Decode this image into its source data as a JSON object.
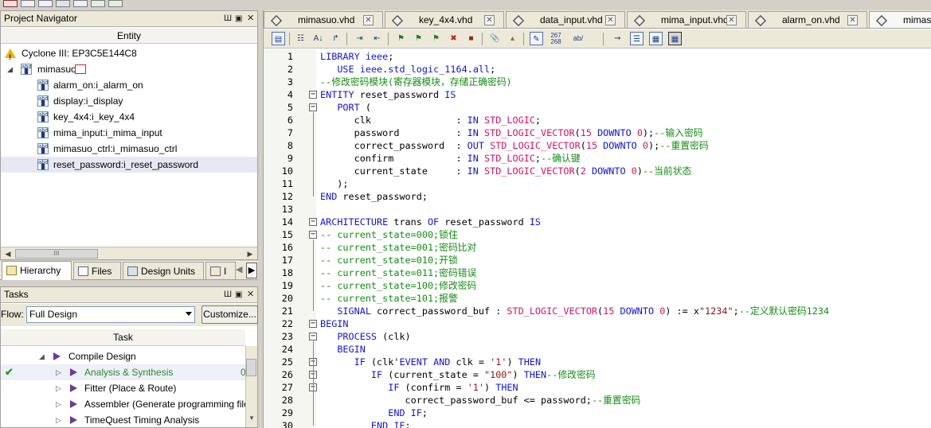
{
  "navigator": {
    "title": "Project Navigator",
    "pin_label": "Ш",
    "column": "Entity",
    "device": "Cyclone III: EP3C5E144C8",
    "root": "mimasuo",
    "children": [
      "alarm_on:i_alarm_on",
      "display:i_display",
      "key_4x4:i_key_4x4",
      "mima_input:i_mima_input",
      "mimasuo_ctrl:i_mimasuo_ctrl",
      "reset_password:i_reset_password"
    ],
    "scroll_thumb": "III",
    "tabs": [
      "Hierarchy",
      "Files",
      "Design Units",
      "I"
    ]
  },
  "tasks": {
    "title": "Tasks",
    "flow_label": "Flow:",
    "flow_value": "Full Design",
    "customize_label": "Customize...",
    "column": "Task",
    "rows": [
      {
        "label": "Compile Design",
        "status": ""
      },
      {
        "label": "Analysis & Synthesis",
        "status": "done",
        "progress": "0"
      },
      {
        "label": "Fitter (Place & Route)",
        "status": ""
      },
      {
        "label": "Assembler (Generate programming files)",
        "status": ""
      },
      {
        "label": "TimeQuest Timing Analysis",
        "status": ""
      }
    ]
  },
  "editor": {
    "tabs": [
      "mimasuo.vhd",
      "key_4x4.vhd",
      "data_input.vhd",
      "mima_input.vhd",
      "alarm_on.vhd",
      "mimasuo"
    ],
    "toolbar_text": {
      "linenum": "267\n268",
      "ab": "ab/"
    },
    "first_line": 1
  },
  "colors": {
    "keyword": "#1414d2",
    "type": "#d01464",
    "comment": "#148c14",
    "string": "#8c1414",
    "tab_bg": "#ece9d8"
  },
  "code_lines": [
    [
      [
        "kw",
        "LIBRARY"
      ],
      [
        "t",
        " "
      ],
      [
        "kw",
        "ieee"
      ],
      [
        "t",
        ";"
      ]
    ],
    [
      [
        "t",
        "   "
      ],
      [
        "kw",
        "USE"
      ],
      [
        "t",
        " "
      ],
      [
        "kw",
        "ieee"
      ],
      [
        "t",
        "."
      ],
      [
        "kw",
        "std_logic_1164"
      ],
      [
        "t",
        "."
      ],
      [
        "kw",
        "all"
      ],
      [
        "t",
        ";"
      ]
    ],
    [
      [
        "cm",
        "--修改密码模块(寄存器模块，存储正确密码)"
      ]
    ],
    [
      [
        "kw",
        "ENTITY"
      ],
      [
        "t",
        " reset_password "
      ],
      [
        "kw",
        "IS"
      ]
    ],
    [
      [
        "t",
        "   "
      ],
      [
        "kw",
        "PORT"
      ],
      [
        "t",
        " ("
      ]
    ],
    [
      [
        "t",
        "      clk               : "
      ],
      [
        "kw",
        "IN"
      ],
      [
        "t",
        " "
      ],
      [
        "ty",
        "STD_LOGIC"
      ],
      [
        "t",
        ";"
      ]
    ],
    [
      [
        "t",
        "      password          : "
      ],
      [
        "kw",
        "IN"
      ],
      [
        "t",
        " "
      ],
      [
        "ty",
        "STD_LOGIC_VECTOR"
      ],
      [
        "t",
        "("
      ],
      [
        "nm",
        "15"
      ],
      [
        "t",
        " "
      ],
      [
        "kw",
        "DOWNTO"
      ],
      [
        "t",
        " "
      ],
      [
        "nm",
        "0"
      ],
      [
        "t",
        ");"
      ],
      [
        "cm",
        "--输入密码"
      ]
    ],
    [
      [
        "t",
        "      correct_password  : "
      ],
      [
        "kw",
        "OUT"
      ],
      [
        "t",
        " "
      ],
      [
        "ty",
        "STD_LOGIC_VECTOR"
      ],
      [
        "t",
        "("
      ],
      [
        "nm",
        "15"
      ],
      [
        "t",
        " "
      ],
      [
        "kw",
        "DOWNTO"
      ],
      [
        "t",
        " "
      ],
      [
        "nm",
        "0"
      ],
      [
        "t",
        ");"
      ],
      [
        "cm",
        "--重置密码"
      ]
    ],
    [
      [
        "t",
        "      confirm           : "
      ],
      [
        "kw",
        "IN"
      ],
      [
        "t",
        " "
      ],
      [
        "ty",
        "STD_LOGIC"
      ],
      [
        "t",
        ";"
      ],
      [
        "cm",
        "--确认键"
      ]
    ],
    [
      [
        "t",
        "      current_state     : "
      ],
      [
        "kw",
        "IN"
      ],
      [
        "t",
        " "
      ],
      [
        "ty",
        "STD_LOGIC_VECTOR"
      ],
      [
        "t",
        "("
      ],
      [
        "nm",
        "2"
      ],
      [
        "t",
        " "
      ],
      [
        "kw",
        "DOWNTO"
      ],
      [
        "t",
        " "
      ],
      [
        "nm",
        "0"
      ],
      [
        "t",
        ")"
      ],
      [
        "cm",
        "--当前状态"
      ]
    ],
    [
      [
        "t",
        "   );"
      ]
    ],
    [
      [
        "kw",
        "END"
      ],
      [
        "t",
        " reset_password;"
      ]
    ],
    [
      [
        "t",
        ""
      ]
    ],
    [
      [
        "kw",
        "ARCHITECTURE"
      ],
      [
        "t",
        " trans "
      ],
      [
        "kw",
        "OF"
      ],
      [
        "t",
        " reset_password "
      ],
      [
        "kw",
        "IS"
      ]
    ],
    [
      [
        "cm",
        "-- current_state=000;锁住"
      ]
    ],
    [
      [
        "cm",
        "-- current_state=001;密码比对"
      ]
    ],
    [
      [
        "cm",
        "-- current_state=010;开锁"
      ]
    ],
    [
      [
        "cm",
        "-- current_state=011;密码错误"
      ]
    ],
    [
      [
        "cm",
        "-- current_state=100;修改密码"
      ]
    ],
    [
      [
        "cm",
        "-- current_state=101;报警"
      ]
    ],
    [
      [
        "t",
        "   "
      ],
      [
        "kw",
        "SIGNAL"
      ],
      [
        "t",
        " correct_password_buf : "
      ],
      [
        "ty",
        "STD_LOGIC_VECTOR"
      ],
      [
        "t",
        "("
      ],
      [
        "nm",
        "15"
      ],
      [
        "t",
        " "
      ],
      [
        "kw",
        "DOWNTO"
      ],
      [
        "t",
        " "
      ],
      [
        "nm",
        "0"
      ],
      [
        "t",
        ") := x"
      ],
      [
        "st",
        "\"1234\""
      ],
      [
        "t",
        ";"
      ],
      [
        "cm",
        "--定义默认密码1234"
      ]
    ],
    [
      [
        "kw",
        "BEGIN"
      ]
    ],
    [
      [
        "t",
        "   "
      ],
      [
        "kw",
        "PROCESS"
      ],
      [
        "t",
        " (clk)"
      ]
    ],
    [
      [
        "t",
        "   "
      ],
      [
        "kw",
        "BEGIN"
      ]
    ],
    [
      [
        "t",
        "      "
      ],
      [
        "kw",
        "IF"
      ],
      [
        "t",
        " (clk'"
      ],
      [
        "kw",
        "EVENT"
      ],
      [
        "t",
        " "
      ],
      [
        "kw",
        "AND"
      ],
      [
        "t",
        " clk = "
      ],
      [
        "st",
        "'1'"
      ],
      [
        "t",
        ") "
      ],
      [
        "kw",
        "THEN"
      ]
    ],
    [
      [
        "t",
        "         "
      ],
      [
        "kw",
        "IF"
      ],
      [
        "t",
        " (current_state = "
      ],
      [
        "st",
        "\"100\""
      ],
      [
        "t",
        ") "
      ],
      [
        "kw",
        "THEN"
      ],
      [
        "cm",
        "--修改密码"
      ]
    ],
    [
      [
        "t",
        "            "
      ],
      [
        "kw",
        "IF"
      ],
      [
        "t",
        " (confirm = "
      ],
      [
        "st",
        "'1'"
      ],
      [
        "t",
        ") "
      ],
      [
        "kw",
        "THEN"
      ]
    ],
    [
      [
        "t",
        "               correct_password_buf <= password;"
      ],
      [
        "cm",
        "--重置密码"
      ]
    ],
    [
      [
        "t",
        "            "
      ],
      [
        "kw",
        "END IF"
      ],
      [
        "t",
        ";"
      ]
    ],
    [
      [
        "t",
        "         "
      ],
      [
        "kw",
        "END IF"
      ],
      [
        "t",
        ";"
      ]
    ]
  ]
}
